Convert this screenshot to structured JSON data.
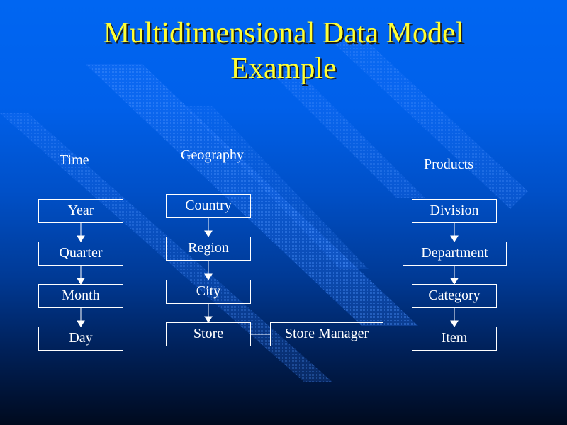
{
  "slide": {
    "title_line1": "Multidimensional Data Model",
    "title_line2": "Example",
    "colors": {
      "title": "#ffff33",
      "text": "#ffffff",
      "background_top": "#0066f2",
      "background_bottom": "#000a1e"
    }
  },
  "dimensions": {
    "time": {
      "label": "Time",
      "levels": [
        "Year",
        "Quarter",
        "Month",
        "Day"
      ]
    },
    "geography": {
      "label": "Geography",
      "levels": [
        "Country",
        "Region",
        "City",
        "Store"
      ],
      "attribute": "Store Manager"
    },
    "products": {
      "label": "Products",
      "levels": [
        "Division",
        "Department",
        "Category",
        "Item"
      ]
    }
  }
}
